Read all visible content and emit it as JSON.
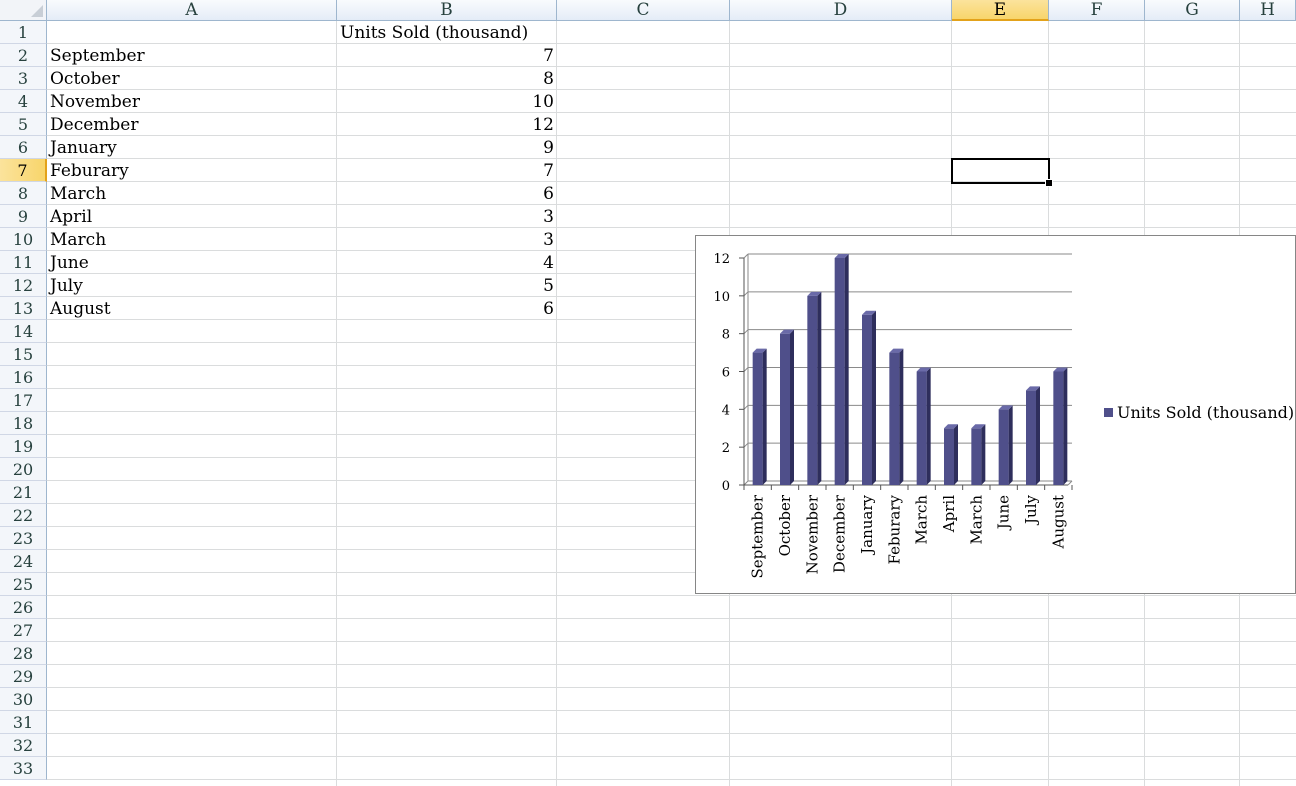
{
  "columns": [
    "A",
    "B",
    "C",
    "D",
    "E",
    "F",
    "G",
    "H"
  ],
  "selected_column": "E",
  "rows": [
    "1",
    "2",
    "3",
    "4",
    "5",
    "6",
    "7",
    "8",
    "9",
    "10",
    "11",
    "12",
    "13",
    "14",
    "15",
    "16",
    "17",
    "18",
    "19",
    "20",
    "21",
    "22",
    "23",
    "24",
    "25",
    "26",
    "27",
    "28",
    "29",
    "30",
    "31",
    "32",
    "33"
  ],
  "selected_row": "7",
  "header_cell": "Units Sold (thousand)",
  "data_rows": [
    {
      "month": "September",
      "units": "7"
    },
    {
      "month": "October",
      "units": "8"
    },
    {
      "month": "November",
      "units": "10"
    },
    {
      "month": "December",
      "units": "12"
    },
    {
      "month": "January",
      "units": "9"
    },
    {
      "month": "Feburary",
      "units": "7"
    },
    {
      "month": "March",
      "units": "6"
    },
    {
      "month": "April",
      "units": "3"
    },
    {
      "month": "March",
      "units": "3"
    },
    {
      "month": "June",
      "units": "4"
    },
    {
      "month": "July",
      "units": "5"
    },
    {
      "month": "August",
      "units": "6"
    }
  ],
  "colors": {
    "bar": "#4f4f8a",
    "bar_dark": "#2e2e5c",
    "bar_top": "#6a6aa8",
    "selection": "#f8d56b"
  },
  "chart_data": {
    "type": "bar",
    "categories": [
      "September",
      "October",
      "November",
      "December",
      "January",
      "Feburary",
      "March",
      "April",
      "March",
      "June",
      "July",
      "August"
    ],
    "series": [
      {
        "name": "Units Sold (thousand)",
        "values": [
          7,
          8,
          10,
          12,
          9,
          7,
          6,
          3,
          3,
          4,
          5,
          6
        ]
      }
    ],
    "ylim": [
      0,
      12
    ],
    "yticks": [
      0,
      2,
      4,
      6,
      8,
      10,
      12
    ],
    "grid": true,
    "legend": "right"
  }
}
